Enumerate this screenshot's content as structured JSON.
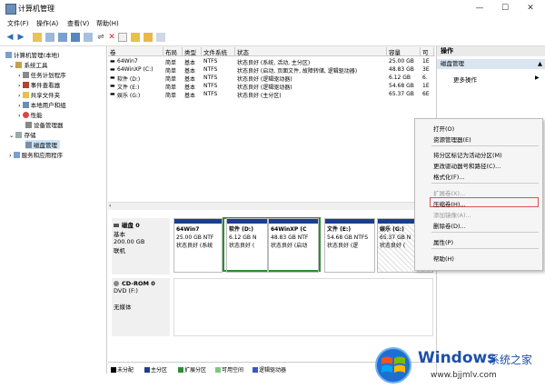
{
  "window": {
    "title": "计算机管理"
  },
  "menu": [
    "文件(F)",
    "操作(A)",
    "查看(V)",
    "帮助(H)"
  ],
  "tree": {
    "root": "计算机管理(本地)",
    "system_tools": "系统工具",
    "task_scheduler": "任务计划程序",
    "event_viewer": "事件查看器",
    "shared_folders": "共享文件夹",
    "local_users": "本地用户和组",
    "performance": "性能",
    "device_manager": "设备管理器",
    "storage": "存储",
    "disk_management": "磁盘管理",
    "services": "服务和应用程序"
  },
  "table": {
    "headers": [
      "卷",
      "布局",
      "类型",
      "文件系统",
      "状态",
      "容量",
      "可"
    ],
    "rows": [
      {
        "vol": "64Win7",
        "layout": "简单",
        "type": "基本",
        "fs": "NTFS",
        "status": "状态良好 (系统, 活动, 主分区)",
        "cap": "25.00 GB",
        "free": "1E"
      },
      {
        "vol": "64WinXP (C:)",
        "layout": "简单",
        "type": "基本",
        "fs": "NTFS",
        "status": "状态良好 (启动, 页面文件, 故障转储, 逻辑驱动器)",
        "cap": "48.83 GB",
        "free": "3E"
      },
      {
        "vol": "软件 (D:)",
        "layout": "简单",
        "type": "基本",
        "fs": "NTFS",
        "status": "状态良好 (逻辑驱动器)",
        "cap": "6.12 GB",
        "free": "6."
      },
      {
        "vol": "文件 (E:)",
        "layout": "简单",
        "type": "基本",
        "fs": "NTFS",
        "status": "状态良好 (逻辑驱动器)",
        "cap": "54.68 GB",
        "free": "1E"
      },
      {
        "vol": "娱乐 (G:)",
        "layout": "简单",
        "type": "基本",
        "fs": "NTFS",
        "status": "状态良好 (主分区)",
        "cap": "65.37 GB",
        "free": "6E"
      }
    ]
  },
  "disk0": {
    "name": "磁盘 0",
    "type": "基本",
    "size": "200.00 GB",
    "state": "联机",
    "partitions": [
      {
        "name": "64Win7",
        "size": "25.00 GB NTF",
        "status": "状态良好 (系统"
      },
      {
        "name": "软件 (D:)",
        "size": "6.12 GB N",
        "status": "状态良好 ("
      },
      {
        "name": "64WinXP (C",
        "size": "48.83 GB NTF",
        "status": "状态良好 (启动"
      },
      {
        "name": "文件 (E:)",
        "size": "54.68 GB NTFS",
        "status": "状态良好 (逻"
      },
      {
        "name": "娱乐 (G:)",
        "size": "65.37 GB N",
        "status": "状态良好 ("
      }
    ]
  },
  "cdrom": {
    "name": "CD-ROM 0",
    "drive": "DVD (F:)",
    "media": "无媒体"
  },
  "legend": [
    "未分配",
    "主分区",
    "扩展分区",
    "可用空间",
    "逻辑驱动器"
  ],
  "actions": {
    "header": "操作",
    "section": "磁盘管理",
    "more": "更多操作"
  },
  "context_menu": {
    "open": "打开(O)",
    "explorer": "资源管理器(E)",
    "mark_active": "将分区标记为活动分区(M)",
    "change_letter": "更改驱动器号和路径(C)...",
    "format": "格式化(F)...",
    "extend": "扩展卷(X)...",
    "shrink": "压缩卷(H)...",
    "add_mirror": "添加镜像(A)...",
    "delete": "删除卷(D)...",
    "properties": "属性(P)",
    "help": "帮助(H)"
  },
  "watermark": {
    "brand": "Windows",
    "cn": "系统之家",
    "url": "www.bjjmlv.com"
  },
  "colors": {
    "primary": "#1c3d8f",
    "logical": "#1c3d8f",
    "extended": "#2e8b3a",
    "highlight": "#d9534f"
  }
}
